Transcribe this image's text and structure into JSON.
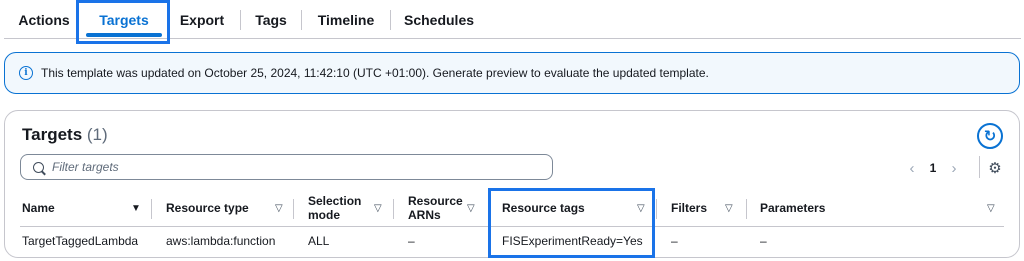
{
  "tabs": [
    {
      "label": "Actions"
    },
    {
      "label": "Targets"
    },
    {
      "label": "Export"
    },
    {
      "label": "Tags"
    },
    {
      "label": "Timeline"
    },
    {
      "label": "Schedules"
    }
  ],
  "active_tab": "Targets",
  "alert": {
    "icon": "info-icon",
    "text": "This template was updated on October 25, 2024, 11:42:10 (UTC +01:00). Generate preview to evaluate the updated template."
  },
  "targets": {
    "title": "Targets",
    "count": "(1)",
    "search_placeholder": "Filter targets",
    "pagination": {
      "current_page": "1"
    },
    "columns": [
      {
        "label": "Name"
      },
      {
        "label": "Resource type"
      },
      {
        "label": "Selection mode"
      },
      {
        "label": "Resource ARNs"
      },
      {
        "label": "Resource tags"
      },
      {
        "label": "Filters"
      },
      {
        "label": "Parameters"
      }
    ],
    "rows": [
      {
        "name": "TargetTaggedLambda",
        "resource_type": "aws:lambda:function",
        "selection_mode": "ALL",
        "resource_arns": "–",
        "resource_tags": "FISExperimentReady=Yes",
        "filters": "–",
        "parameters": "–"
      }
    ]
  },
  "colors": {
    "accent": "#0972d3",
    "highlight_box": "#1a73e8",
    "alert_background": "#f2f8fd",
    "border": "#c6c6cd"
  }
}
